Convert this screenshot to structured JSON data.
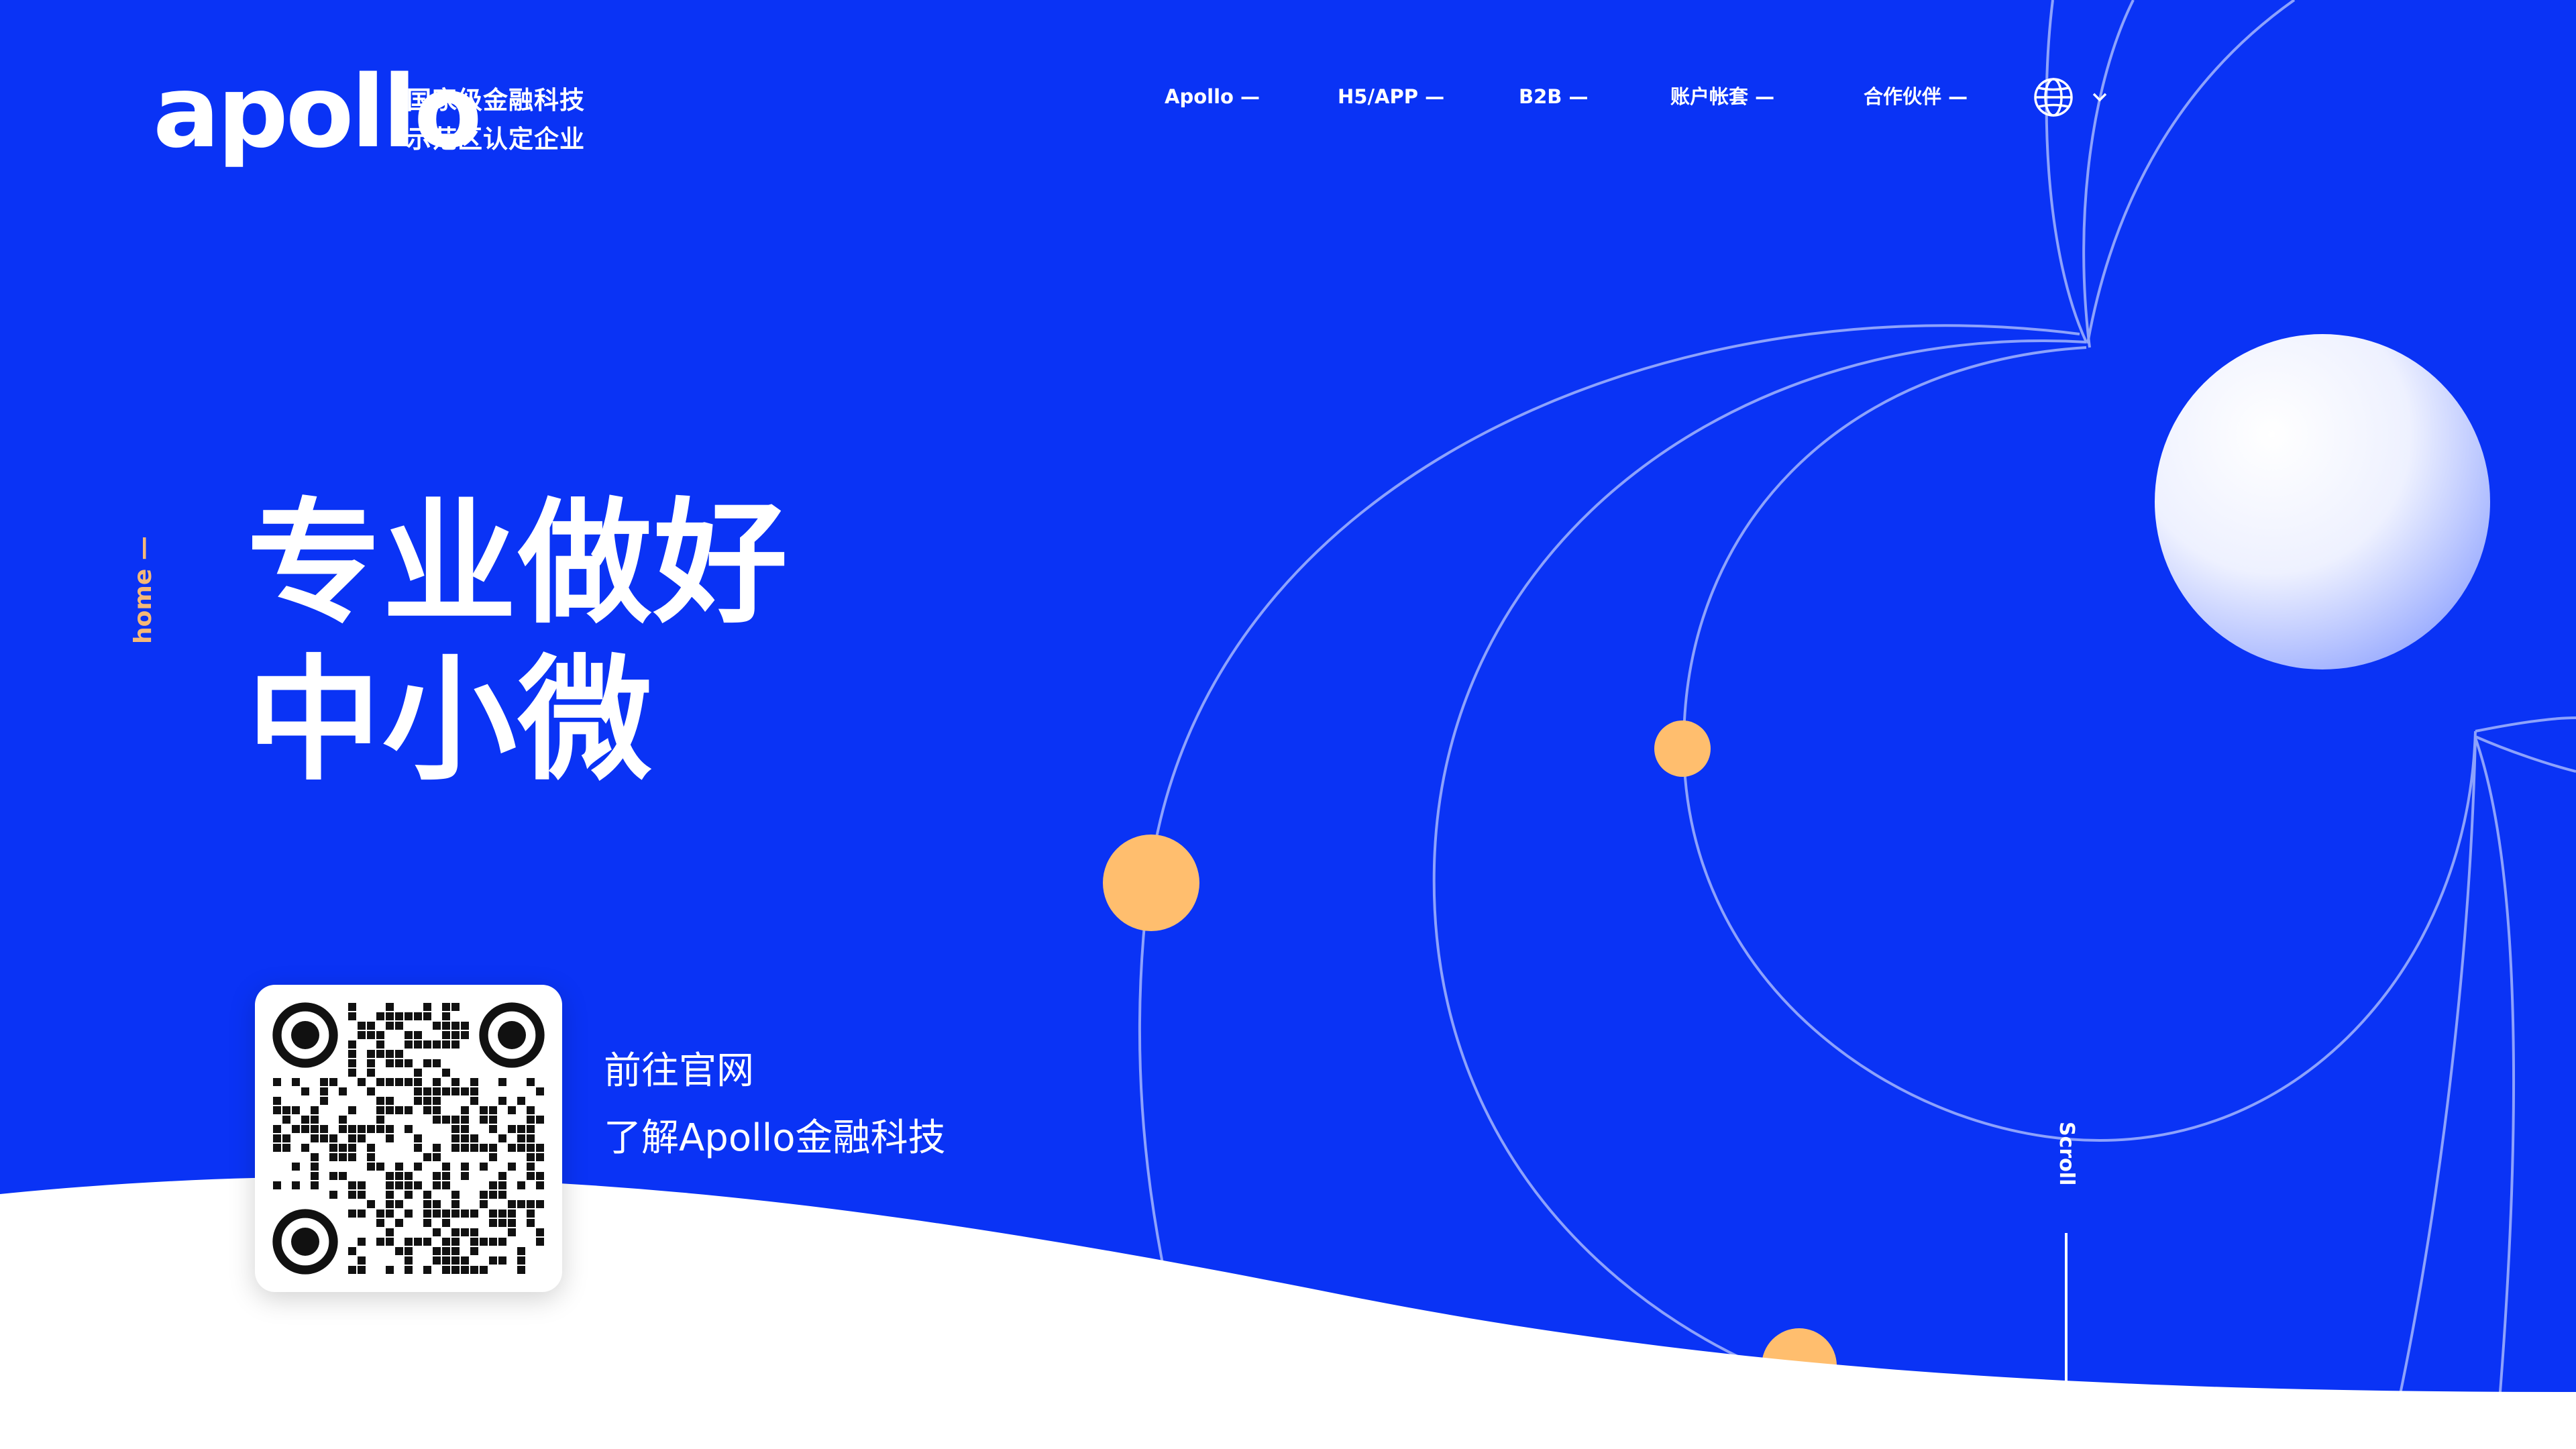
{
  "brand": {
    "logo_text": "apollo",
    "subtitle_line1": "国家级金融科技",
    "subtitle_line2": "示范区认定企业"
  },
  "nav": {
    "items": [
      {
        "label": "Apollo —"
      },
      {
        "label": "H5/APP —"
      },
      {
        "label": "B2B —"
      },
      {
        "label": "账户帐套 —"
      },
      {
        "label": "合作伙伴 —"
      }
    ],
    "language_icon": "globe-icon",
    "dropdown_icon": "chevron-down-icon"
  },
  "side": {
    "section_label": "home —"
  },
  "hero": {
    "line1": "专业做好",
    "line2": "中小微"
  },
  "cta": {
    "qr_icon": "qr-code",
    "line1": "前往官网",
    "line2": "了解Apollo金融科技"
  },
  "scroll": {
    "label": "Scroll"
  },
  "colors": {
    "background": "#0a33f5",
    "accent_orange": "#ffbe6e",
    "side_label": "#f5b877",
    "wave": "#ffffff",
    "text": "#ffffff"
  }
}
